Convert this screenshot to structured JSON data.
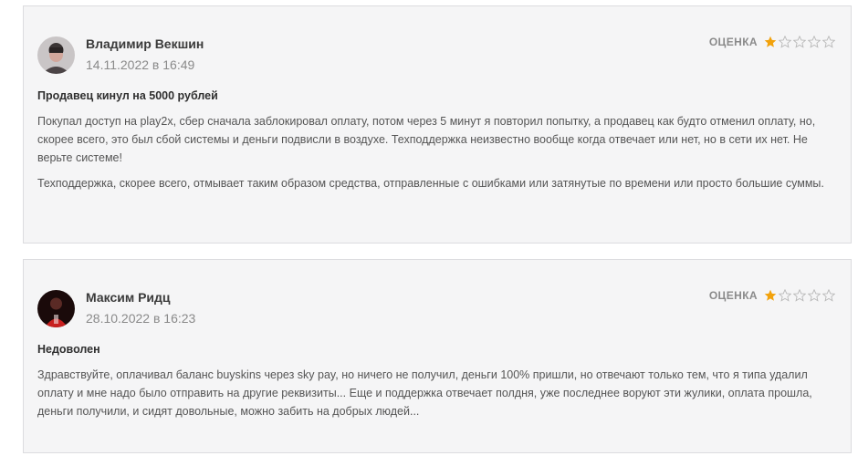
{
  "reviews": [
    {
      "author": "Владимир Векшин",
      "date": "14.11.2022 в 16:49",
      "rating_label": "ОЦЕНКА",
      "rating": 1,
      "rating_max": 5,
      "title": "Продавец кинул на 5000 рублей",
      "paragraphs": [
        "Покупал доступ на play2x, сбер сначала заблокировал оплату, потом через 5 минут я повторил попытку, а продавец как будто отменил оплату, но, скорее всего, это был сбой системы и деньги подвисли в воздухе. Техподдержка неизвестно вообще когда отвечает или нет, но в сети их нет. Не верьте системе!",
        "Техподдержка, скорее всего, отмывает таким образом средства, отправленные с ошибками или затянутые по времени или просто большие суммы."
      ]
    },
    {
      "author": "Максим Ридц",
      "date": "28.10.2022 в 16:23",
      "rating_label": "ОЦЕНКА",
      "rating": 1,
      "rating_max": 5,
      "title": "Недоволен",
      "paragraphs": [
        "Здравствуйте, оплачивал баланс buyskins через sky pay, но ничего не получил, деньги 100% пришли, но отвечают только тем, что я типа удалил оплату и мне надо было отправить на другие реквизиты... Еще и поддержка отвечает полдня, уже последнее воруют эти жулики, оплата прошла, деньги получили, и сидят довольные, можно забить на добрых людей..."
      ]
    }
  ],
  "colors": {
    "star_filled": "#f2a20c",
    "star_empty": "#b8b8b8"
  }
}
